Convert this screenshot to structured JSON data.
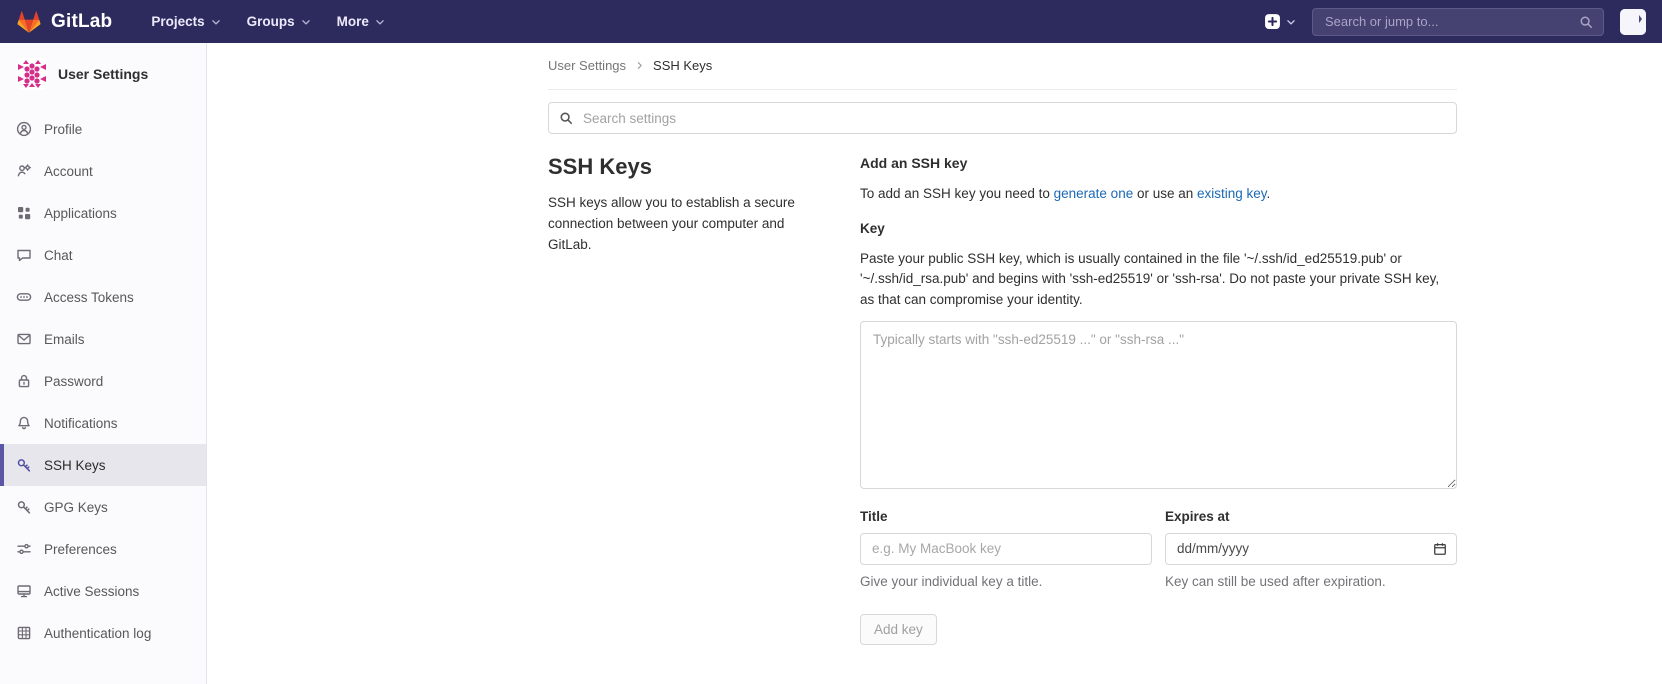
{
  "navbar": {
    "brand": "GitLab",
    "menu": [
      {
        "label": "Projects"
      },
      {
        "label": "Groups"
      },
      {
        "label": "More"
      }
    ],
    "search_placeholder": "Search or jump to...",
    "bg_color": "#2d2b5e"
  },
  "sidebar": {
    "title": "User Settings",
    "items": [
      {
        "label": "Profile",
        "icon": "profile-icon",
        "active": false
      },
      {
        "label": "Account",
        "icon": "account-icon",
        "active": false
      },
      {
        "label": "Applications",
        "icon": "applications-icon",
        "active": false
      },
      {
        "label": "Chat",
        "icon": "chat-icon",
        "active": false
      },
      {
        "label": "Access Tokens",
        "icon": "token-icon",
        "active": false
      },
      {
        "label": "Emails",
        "icon": "email-icon",
        "active": false
      },
      {
        "label": "Password",
        "icon": "lock-icon",
        "active": false
      },
      {
        "label": "Notifications",
        "icon": "bell-icon",
        "active": false
      },
      {
        "label": "SSH Keys",
        "icon": "key-icon",
        "active": true
      },
      {
        "label": "GPG Keys",
        "icon": "key-icon",
        "active": false
      },
      {
        "label": "Preferences",
        "icon": "sliders-icon",
        "active": false
      },
      {
        "label": "Active Sessions",
        "icon": "monitor-icon",
        "active": false
      },
      {
        "label": "Authentication log",
        "icon": "log-icon",
        "active": false
      }
    ],
    "active_accent": "#5a55a5"
  },
  "breadcrumb": {
    "parent": "User Settings",
    "current": "SSH Keys"
  },
  "settings_search": {
    "placeholder": "Search settings"
  },
  "main": {
    "heading": "SSH Keys",
    "description": "SSH keys allow you to establish a secure connection between your computer and GitLab.",
    "form": {
      "section_title": "Add an SSH key",
      "intro_pre": "To add an SSH key you need to ",
      "intro_link1": "generate one",
      "intro_mid": " or use an ",
      "intro_link2": "existing key",
      "intro_post": ".",
      "key_label": "Key",
      "key_help": "Paste your public SSH key, which is usually contained in the file '~/.ssh/id_ed25519.pub' or '~/.ssh/id_rsa.pub' and begins with 'ssh-ed25519' or 'ssh-rsa'. Do not paste your private SSH key, as that can compromise your identity.",
      "key_placeholder": "Typically starts with \"ssh-ed25519 ...\" or \"ssh-rsa ...\"",
      "title_label": "Title",
      "title_placeholder": "e.g. My MacBook key",
      "title_help": "Give your individual key a title.",
      "expires_label": "Expires at",
      "expires_value": "dd/mm/yyyy",
      "expires_help": "Key can still be used after expiration.",
      "submit_label": "Add key",
      "link_color": "#1b69b6"
    }
  }
}
